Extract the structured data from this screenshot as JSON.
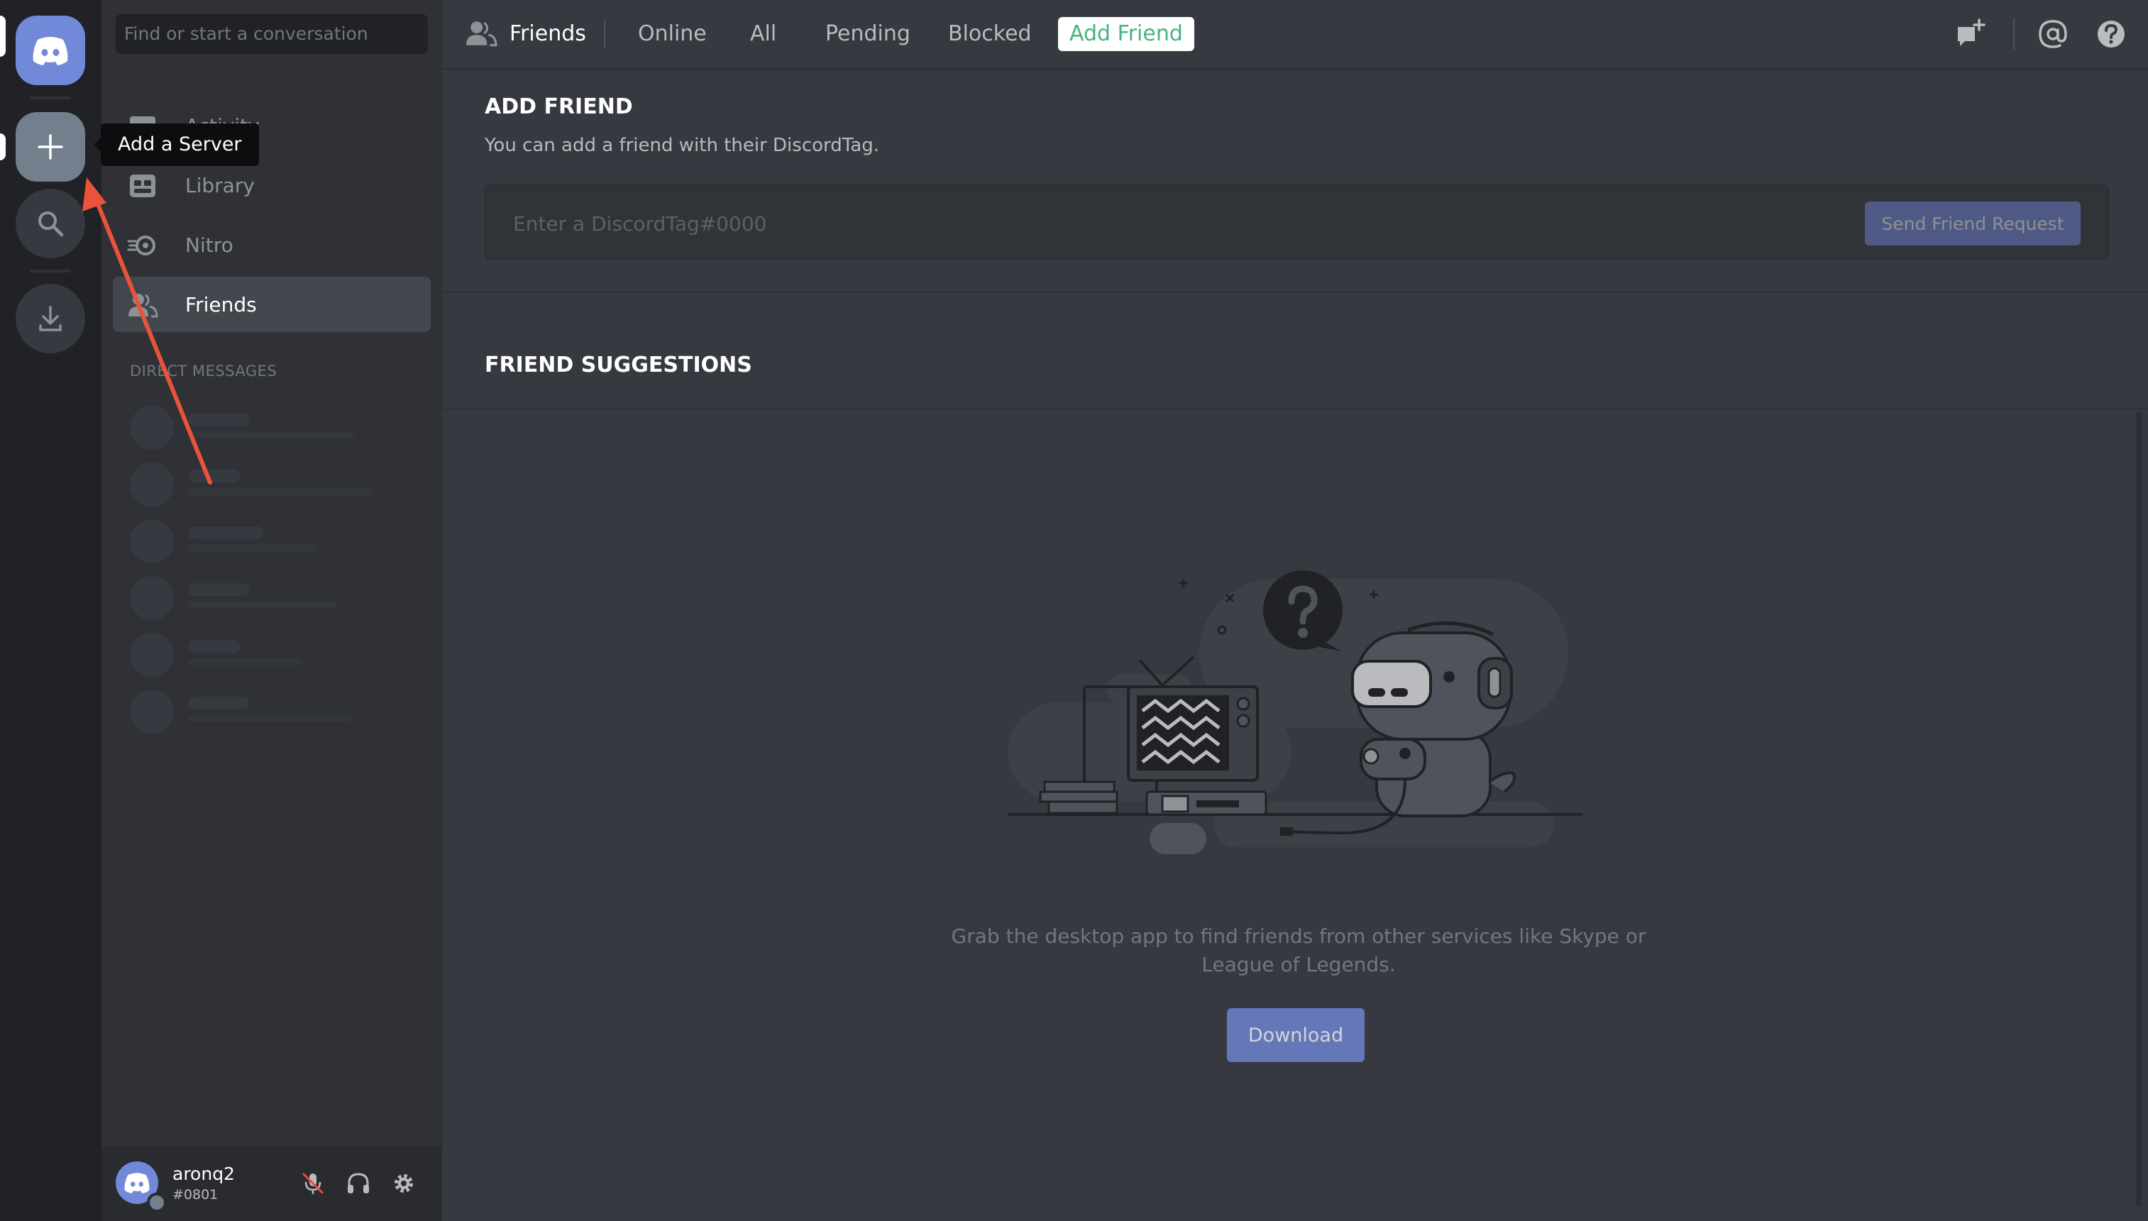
{
  "search": {
    "placeholder": "Find or start a conversation"
  },
  "rail": {
    "tooltip": "Add a Server",
    "icons": [
      "discord-logo-icon",
      "plus-icon",
      "search-icon",
      "download-icon"
    ]
  },
  "sidebar": {
    "items": [
      {
        "label": "Activity",
        "icon": "activity-icon"
      },
      {
        "label": "Library",
        "icon": "library-icon"
      },
      {
        "label": "Nitro",
        "icon": "nitro-icon"
      },
      {
        "label": "Friends",
        "icon": "friends-icon",
        "active": true
      }
    ],
    "dm_header": "DIRECT MESSAGES"
  },
  "user": {
    "name": "aronq2",
    "discriminator": "#0801"
  },
  "header": {
    "title": "Friends",
    "tabs": [
      "Online",
      "All",
      "Pending",
      "Blocked",
      "Add Friend"
    ],
    "icons": [
      "new-group-dm-icon",
      "mentions-icon",
      "help-icon"
    ]
  },
  "add_friend": {
    "title": "ADD FRIEND",
    "description": "You can add a friend with their DiscordTag.",
    "input_placeholder": "Enter a DiscordTag#0000",
    "send_button": "Send Friend Request"
  },
  "suggestions": {
    "title": "FRIEND SUGGESTIONS",
    "empty_text": "Grab the desktop app to find friends from other services like Skype or League of Legends.",
    "download_button": "Download"
  },
  "colors": {
    "accent": "#7289da",
    "online_green": "#43b581",
    "annotation_arrow": "#e8533a"
  }
}
